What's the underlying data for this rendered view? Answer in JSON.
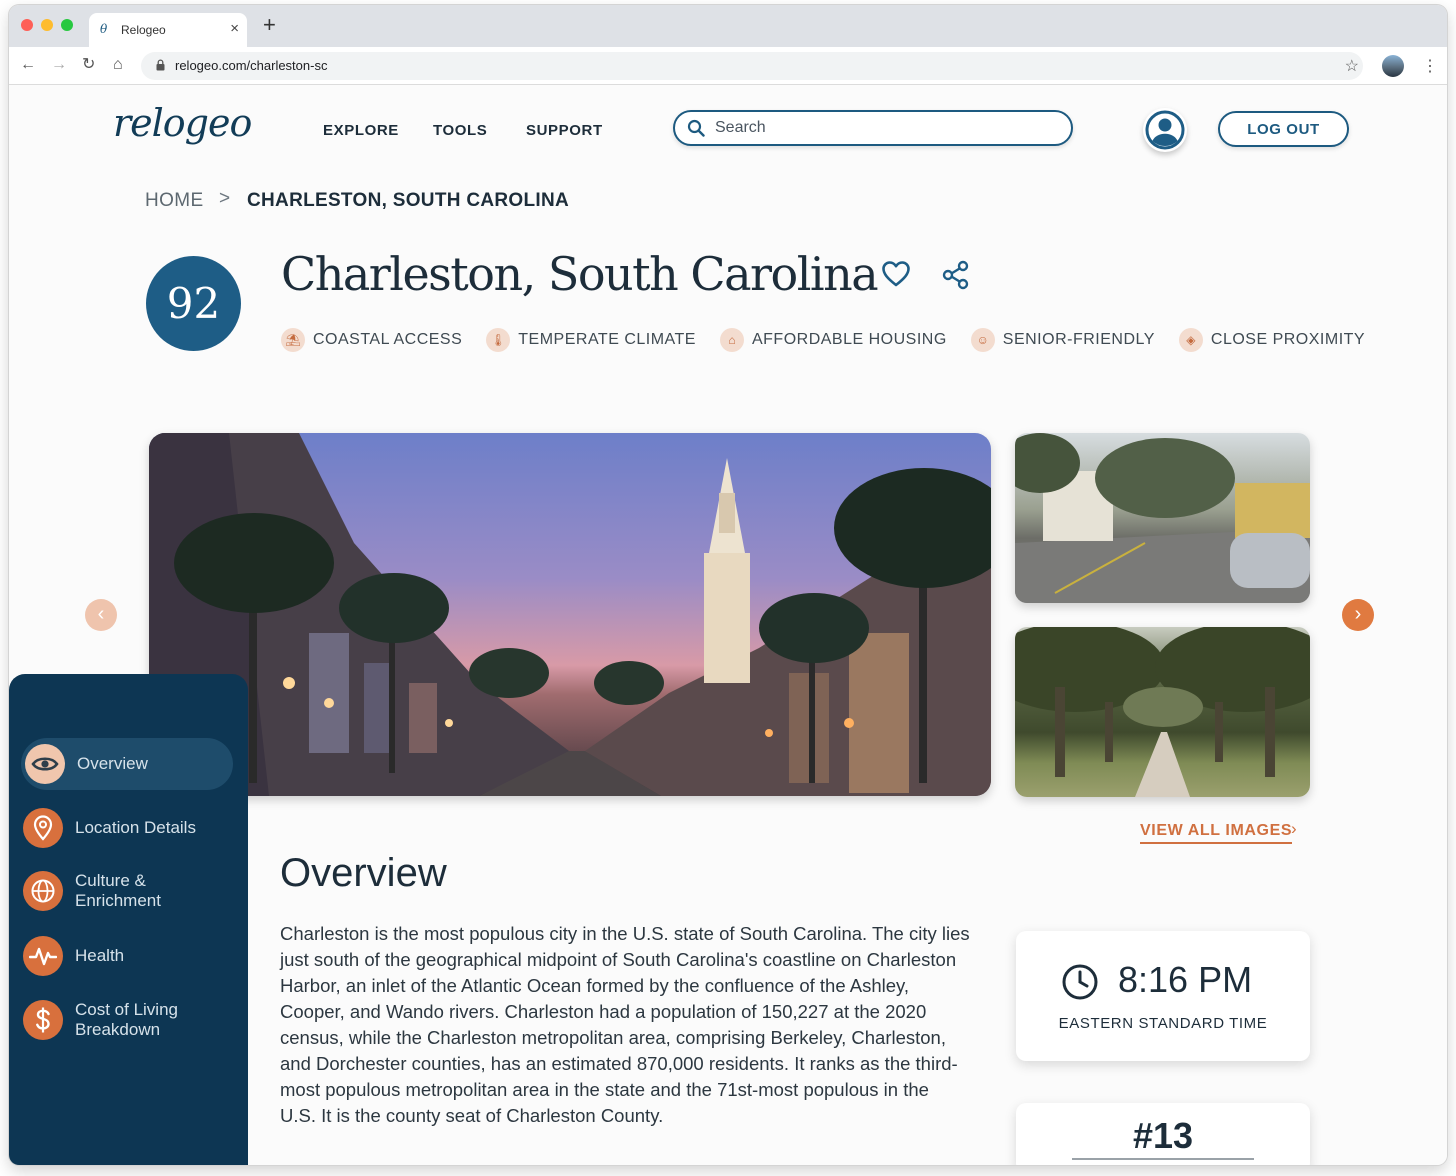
{
  "browser": {
    "tab_title": "Relogeo",
    "tab_favicon": "θ",
    "url": "relogeo.com/charleston-sc"
  },
  "header": {
    "logo": "relogeo",
    "nav": [
      "EXPLORE",
      "TOOLS",
      "SUPPORT"
    ],
    "search_placeholder": "Search",
    "logout_label": "LOG OUT"
  },
  "breadcrumb": {
    "home": "HOME",
    "separator": ">",
    "current": "CHARLESTON, SOUTH CAROLINA"
  },
  "city": {
    "score": "92",
    "title": "Charleston, South Carolina",
    "tags": [
      {
        "label": "COASTAL ACCESS",
        "icon": "beach-icon"
      },
      {
        "label": "TEMPERATE CLIMATE",
        "icon": "thermometer-icon"
      },
      {
        "label": "AFFORDABLE HOUSING",
        "icon": "house-icon"
      },
      {
        "label": "SENIOR-FRIENDLY",
        "icon": "senior-icon"
      },
      {
        "label": "CLOSE PROXIMITY",
        "icon": "location-icon"
      }
    ]
  },
  "gallery": {
    "view_all_label": "VIEW ALL IMAGES"
  },
  "overview": {
    "title": "Overview",
    "text": "Charleston is the most populous city in the U.S. state of South Carolina. The city lies just south of the geographical midpoint of South Carolina's coastline on Charleston Harbor, an inlet of the Atlantic Ocean formed by the confluence of the Ashley, Cooper, and Wando rivers. Charleston had a population of 150,227 at the 2020 census, while the Charleston metropolitan area, comprising Berkeley, Charleston, and Dorchester counties, has an estimated 870,000 residents. It ranks as the third-most populous metropolitan area in the state and the 71st-most populous in the U.S. It is the county seat of Charleston County."
  },
  "time_card": {
    "time": "8:16 PM",
    "zone": "EASTERN STANDARD TIME"
  },
  "rank_card": {
    "rank": "#13"
  },
  "sidebar": {
    "items": [
      {
        "label": "Overview",
        "icon": "eye-icon",
        "active": true
      },
      {
        "label": "Location Details",
        "icon": "map-pin-icon",
        "active": false
      },
      {
        "label": "Culture & Enrichment",
        "icon": "globe-icon",
        "active": false
      },
      {
        "label": "Health",
        "icon": "heartbeat-icon",
        "active": false
      },
      {
        "label": "Cost of Living Breakdown",
        "icon": "dollar-icon",
        "active": false
      }
    ]
  },
  "colors": {
    "brand_navy": "#1e5d86",
    "sidebar_bg": "#0d3653",
    "accent_orange": "#d8703d"
  }
}
